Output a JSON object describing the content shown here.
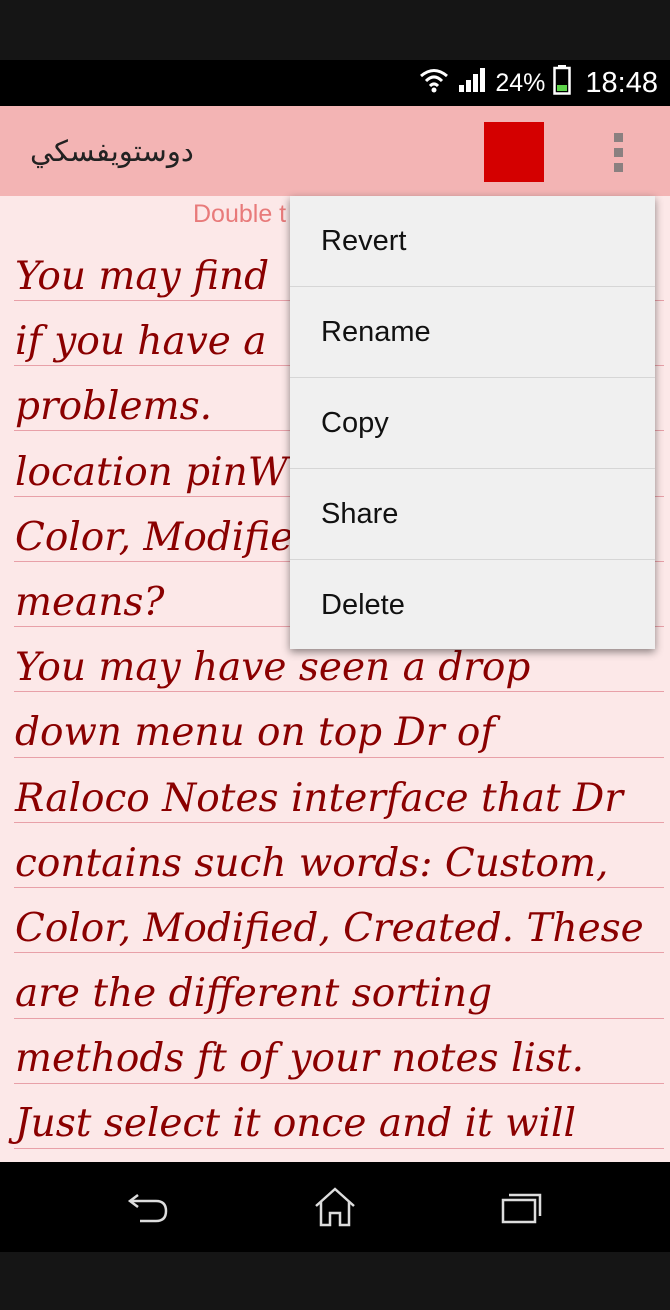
{
  "status_bar": {
    "battery_percent": "24%",
    "time": "18:48",
    "icons": [
      "wifi-icon",
      "signal-icon",
      "battery-icon"
    ]
  },
  "app_bar": {
    "title": "دوستويفسكي",
    "color_swatch": "#d40000",
    "background": "#f3b4b4",
    "overflow_icon": "more-vert-icon"
  },
  "note": {
    "hint": "Double t",
    "lines": [
      "You may find",
      "if you have a",
      "problems.",
      "location pinW",
      "Color, Modifie",
      "means?",
      "You may have seen a drop",
      "down menu on top Dr of",
      "Raloco Notes interface that Dr",
      "contains such words: Custom,",
      "Color, Modified, Created. These",
      "are the different sorting",
      "methods ft of your notes list.",
      "Just select it once and it will"
    ],
    "text_color": "#8a0000",
    "paper_color": "#fce8e8"
  },
  "menu": {
    "items": [
      {
        "label": "Revert"
      },
      {
        "label": "Rename"
      },
      {
        "label": "Copy"
      },
      {
        "label": "Share"
      },
      {
        "label": "Delete"
      }
    ]
  },
  "nav_bar": {
    "icons": [
      "back-icon",
      "home-icon",
      "recents-icon"
    ]
  }
}
